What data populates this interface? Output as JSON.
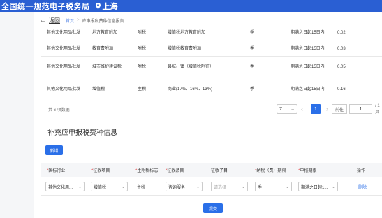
{
  "header": {
    "site_title": "全国统一规范电子税务局",
    "region": "上海"
  },
  "breadcrumb": {
    "back_label": "返回",
    "home": "首页",
    "current": "应申报税费种信息报告"
  },
  "upper_table": {
    "rows": [
      [
        "其他文化用品批发",
        "地方教育附加",
        "附税",
        "增值税地方教育附加",
        "季",
        "期满之日起15日内",
        "0.02"
      ],
      [
        "其他文化用品批发",
        "教育费附加",
        "附税",
        "增值税教育费附加",
        "季",
        "期满之日起15日内",
        "0.03"
      ],
      [
        "其他文化用品批发",
        "城市维护建设税",
        "附税",
        "县城、镇（增值税附征）",
        "季",
        "期满之日起15日内",
        "0.05"
      ],
      [
        "其他文化用品批发",
        "增值税",
        "主税",
        "商业(17%、16%、13%)",
        "季",
        "期满之日起15日内",
        "0.16"
      ]
    ]
  },
  "pagination": {
    "total_text": "共 6 项数据",
    "page_size": "7",
    "current_page": "1",
    "goto_label": "前往",
    "page_input": "1",
    "page_total": "/ 1 页"
  },
  "section": {
    "title": "补充应申报税费种信息",
    "new_button": "新增"
  },
  "form_table": {
    "headers": {
      "industry": "国标行业",
      "item": "征收项目",
      "main_mark": "主附税标志",
      "category": "征收品目",
      "subitem": "征收子目",
      "period": "纳税（费）期限",
      "deadline": "申报期限",
      "action": "操作"
    },
    "row": {
      "industry": "其他文化用...",
      "item": "增值税",
      "main_mark": "主税",
      "category": "咨询服务",
      "subitem_placeholder": "请选择",
      "period": "季",
      "deadline": "期满之日起1...",
      "delete": "删除"
    }
  },
  "submit_label": "提交",
  "colors": {
    "brand_blue": "#2a5fd3",
    "button_blue": "#2a6fe8",
    "required_red": "#e23b3b"
  }
}
